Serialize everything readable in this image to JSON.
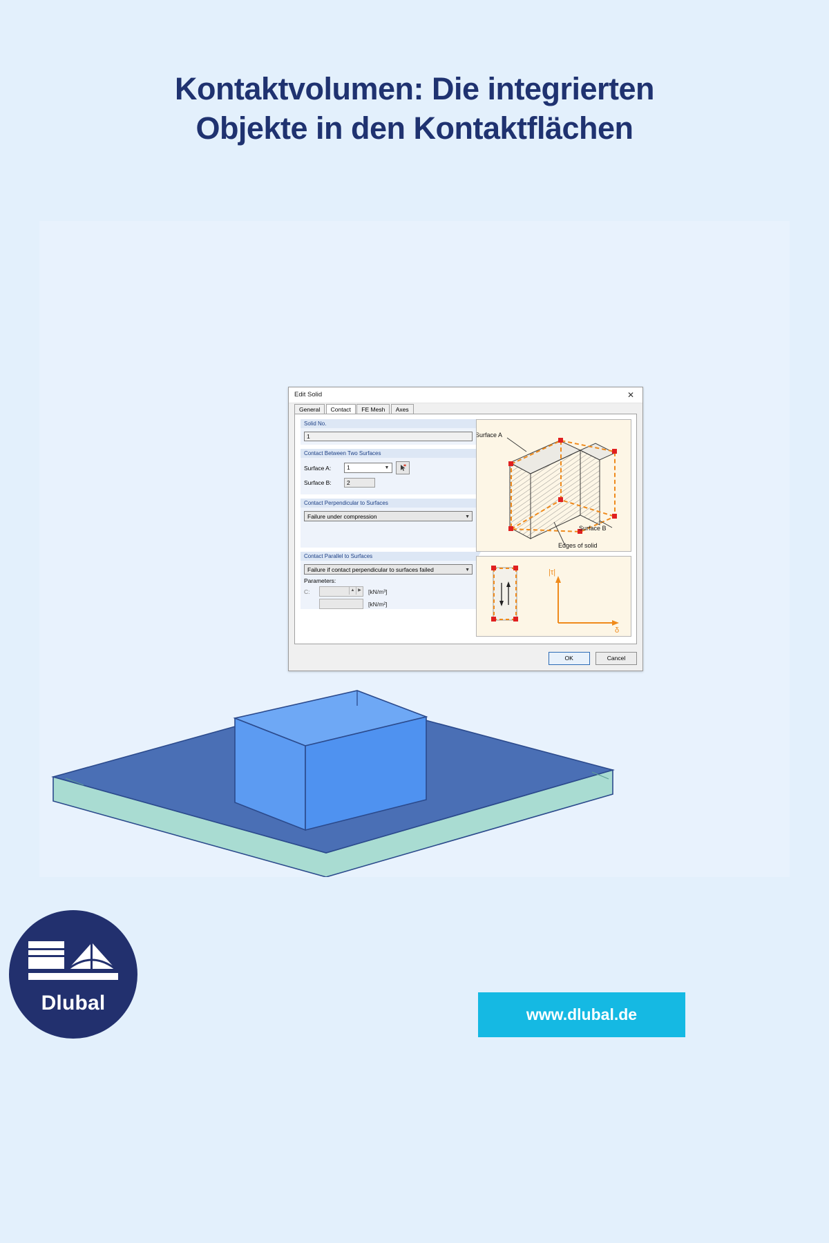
{
  "page": {
    "background_color": "#e3f0fc",
    "panel_color": "#e8f2fd"
  },
  "title": {
    "line1": "Kontaktvolumen: Die integrierten",
    "line2": "Objekte in den Kontaktflächen",
    "color": "#1f3270"
  },
  "dialog": {
    "title": "Edit Solid",
    "close_icon": "close-icon",
    "tabs": [
      {
        "label": "General",
        "active": false
      },
      {
        "label": "Contact",
        "active": true
      },
      {
        "label": "FE Mesh",
        "active": false
      },
      {
        "label": "Axes",
        "active": false
      }
    ],
    "solid_no": {
      "group_label": "Solid No.",
      "value": "1"
    },
    "contact_between": {
      "group_label": "Contact Between Two Surfaces",
      "surface_a_label": "Surface A:",
      "surface_a_value": "1",
      "surface_b_label": "Surface B:",
      "surface_b_value": "2",
      "pick_icon": "pick-surface-icon",
      "chevron_icon": "chevron-down-icon"
    },
    "contact_perpendicular": {
      "group_label": "Contact Perpendicular to Surfaces",
      "value": "Failure under compression"
    },
    "contact_parallel": {
      "group_label": "Contact Parallel to Surfaces",
      "value": "Failure if contact perpendicular to surfaces failed",
      "parameters_label": "Parameters:",
      "rows": [
        {
          "label": "C:",
          "value": "",
          "unit": "[kN/m³]"
        },
        {
          "label": "",
          "value": "",
          "unit": "[kN/m²]"
        }
      ]
    },
    "illustration_top": {
      "label_surface_a": "Surface A",
      "label_surface_b": "Surface B",
      "label_edges": "Edges of solid"
    },
    "illustration_bottom": {
      "axis_y": "|τ|",
      "axis_x": "δ"
    },
    "buttons": {
      "ok": "OK",
      "cancel": "Cancel"
    }
  },
  "model": {
    "slab_top_color": "#4a6fb5",
    "slab_side_color": "#a9dcd2",
    "cube_color": "#5c9bf2",
    "cube_top_color": "#6ea8f5",
    "outline_color": "#2b4a8c"
  },
  "logo": {
    "name": "Dlubal",
    "icon": "dlubal-bridge-icon",
    "bg_color": "#22306e"
  },
  "footer": {
    "url_label": "www.dlubal.de",
    "url_bg_color": "#15b9e3"
  }
}
